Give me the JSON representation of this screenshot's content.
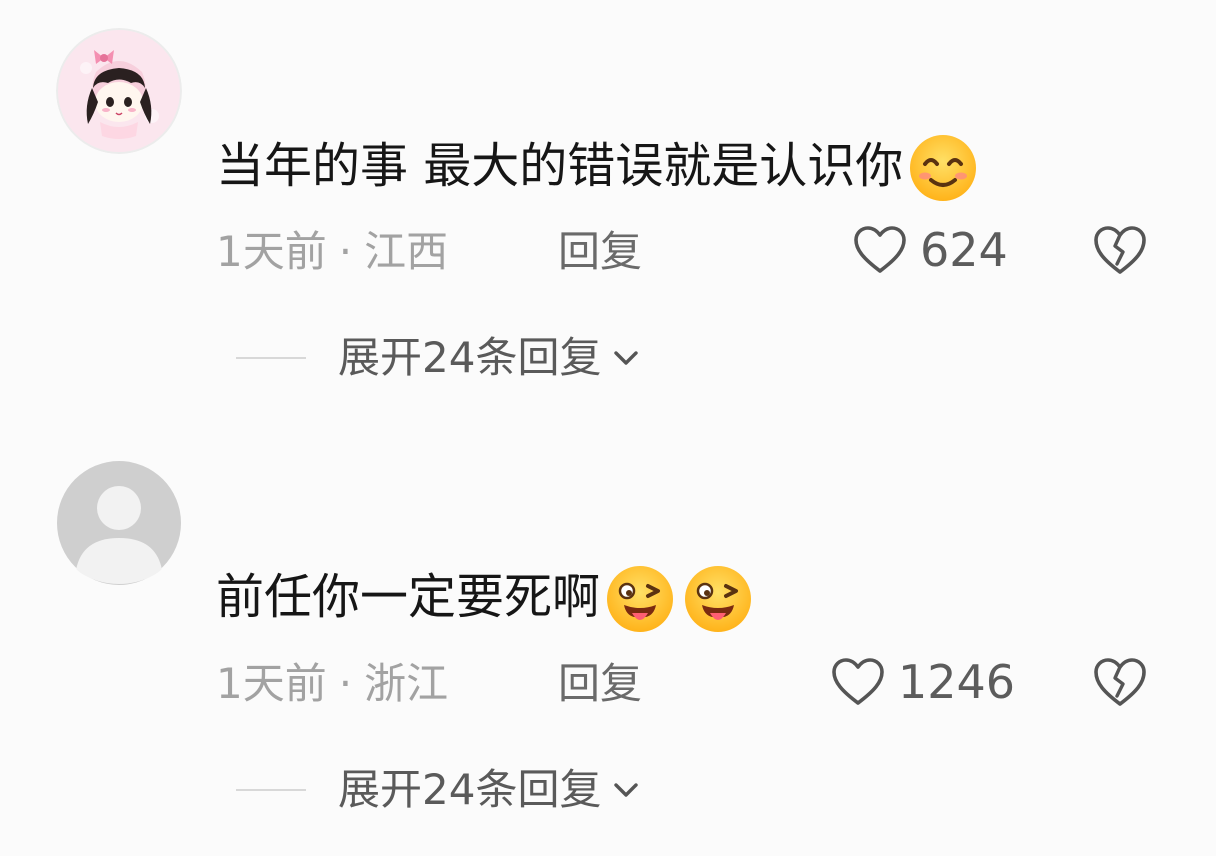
{
  "comments": [
    {
      "text": "当年的事 最大的错误就是认识你",
      "emojis": [
        "smiling-face-icon"
      ],
      "time": "1天前",
      "separator": "·",
      "location": "江西",
      "reply_label": "回复",
      "likes": "624",
      "expand_label": "展开24条回复",
      "avatar": "anime-girl-avatar"
    },
    {
      "text": "前任你一定要死啊",
      "emojis": [
        "winking-tongue-face-icon",
        "winking-tongue-face-icon"
      ],
      "time": "1天前",
      "separator": "·",
      "location": "浙江",
      "reply_label": "回复",
      "likes": "1246",
      "expand_label": "展开24条回复",
      "avatar": "default-user-avatar"
    }
  ],
  "colors": {
    "background": "#fbfbfb",
    "text": "#161616",
    "meta": "#a2a2a2",
    "icon": "#555555",
    "emoji_yellow": "#ffc928"
  }
}
